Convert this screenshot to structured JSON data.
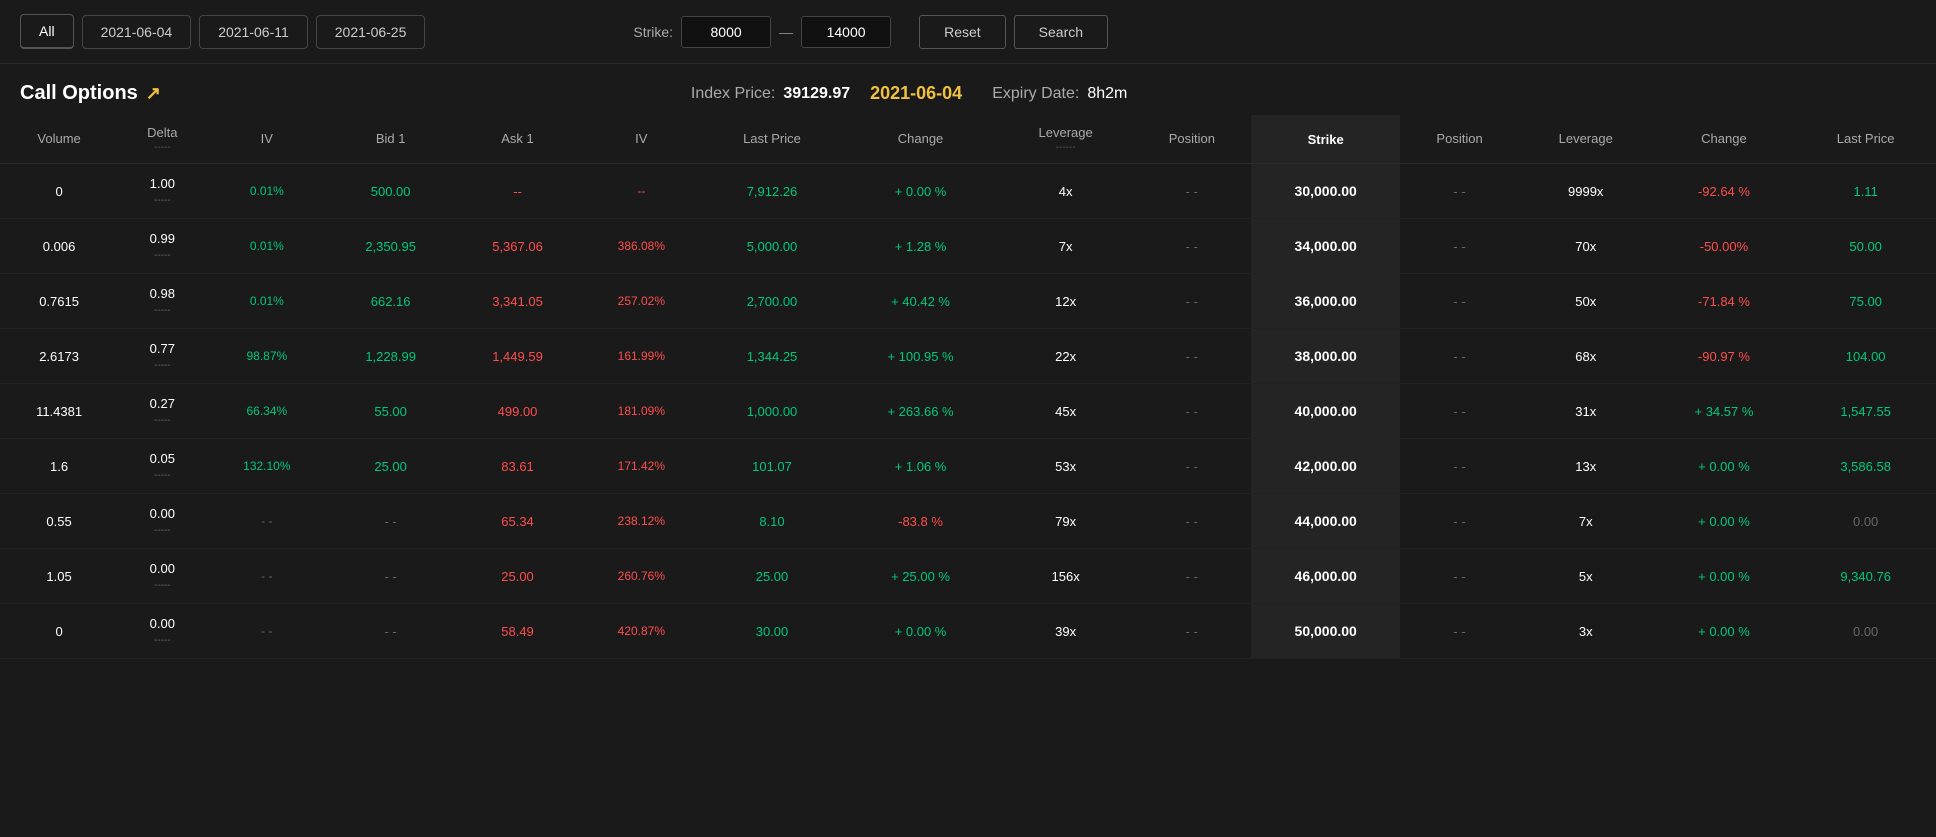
{
  "topbar": {
    "tabs": [
      {
        "label": "All",
        "active": true
      },
      {
        "label": "2021-06-04",
        "active": false
      },
      {
        "label": "2021-06-11",
        "active": false
      },
      {
        "label": "2021-06-25",
        "active": false
      }
    ],
    "strike_label": "Strike:",
    "strike_min": "8000",
    "strike_max": "14000",
    "dash": "—",
    "reset_label": "Reset",
    "search_label": "Search"
  },
  "section": {
    "title": "Call Options",
    "arrow": "↗",
    "index_price_label": "Index Price:",
    "index_price_value": "39129.97",
    "expiry_date": "2021-06-04",
    "expiry_label": "Expiry Date:",
    "expiry_value": "8h2m"
  },
  "columns": {
    "left": [
      "Volume",
      "Delta",
      "IV",
      "Bid 1",
      "Ask 1",
      "IV",
      "Last Price",
      "Change",
      "Leverage",
      "Position"
    ],
    "left_sub": [
      "",
      "-----",
      "",
      "",
      "",
      "",
      "",
      "",
      "------",
      ""
    ],
    "center": "Strike",
    "right": [
      "Position",
      "Leverage",
      "Change",
      "Last Price"
    ]
  },
  "rows": [
    {
      "volume": "0",
      "delta": "1.00",
      "delta_sub": "-----",
      "iv_left": "0.01%",
      "bid1": "500.00",
      "ask1": "--",
      "iv_right": "--",
      "last_price": "7,912.26",
      "change": "+ 0.00 %",
      "leverage": "4x",
      "position_left": "- -",
      "strike": "30,000.00",
      "position_right": "- -",
      "leverage_right": "9999x",
      "change_right": "-92.64 %",
      "last_price_right": "1.11"
    },
    {
      "volume": "0.006",
      "delta": "0.99",
      "delta_sub": "-----",
      "iv_left": "0.01%",
      "bid1": "2,350.95",
      "ask1": "5,367.06",
      "iv_right": "386.08%",
      "last_price": "5,000.00",
      "change": "+ 1.28 %",
      "leverage": "7x",
      "position_left": "- -",
      "strike": "34,000.00",
      "position_right": "- -",
      "leverage_right": "70x",
      "change_right": "-50.00%",
      "last_price_right": "50.00"
    },
    {
      "volume": "0.7615",
      "delta": "0.98",
      "delta_sub": "-----",
      "iv_left": "0.01%",
      "bid1": "662.16",
      "ask1": "3,341.05",
      "iv_right": "257.02%",
      "last_price": "2,700.00",
      "change": "+ 40.42 %",
      "leverage": "12x",
      "position_left": "- -",
      "strike": "36,000.00",
      "position_right": "- -",
      "leverage_right": "50x",
      "change_right": "-71.84 %",
      "last_price_right": "75.00"
    },
    {
      "volume": "2.6173",
      "delta": "0.77",
      "delta_sub": "-----",
      "iv_left": "98.87%",
      "bid1": "1,228.99",
      "ask1": "1,449.59",
      "iv_right": "161.99%",
      "last_price": "1,344.25",
      "change": "+ 100.95 %",
      "leverage": "22x",
      "position_left": "- -",
      "strike": "38,000.00",
      "position_right": "- -",
      "leverage_right": "68x",
      "change_right": "-90.97 %",
      "last_price_right": "104.00"
    },
    {
      "volume": "11.4381",
      "delta": "0.27",
      "delta_sub": "-----",
      "iv_left": "66.34%",
      "bid1": "55.00",
      "ask1": "499.00",
      "iv_right": "181.09%",
      "last_price": "1,000.00",
      "change": "+ 263.66 %",
      "leverage": "45x",
      "position_left": "- -",
      "strike": "40,000.00",
      "position_right": "- -",
      "leverage_right": "31x",
      "change_right": "+ 34.57 %",
      "last_price_right": "1,547.55"
    },
    {
      "volume": "1.6",
      "delta": "0.05",
      "delta_sub": "-----",
      "iv_left": "132.10%",
      "bid1": "25.00",
      "ask1": "83.61",
      "iv_right": "171.42%",
      "last_price": "101.07",
      "change": "+ 1.06 %",
      "leverage": "53x",
      "position_left": "- -",
      "strike": "42,000.00",
      "position_right": "- -",
      "leverage_right": "13x",
      "change_right": "+ 0.00 %",
      "last_price_right": "3,586.58"
    },
    {
      "volume": "0.55",
      "delta": "0.00",
      "delta_sub": "-----",
      "iv_left": "- -",
      "bid1": "- -",
      "ask1": "65.34",
      "iv_right": "238.12%",
      "last_price": "8.10",
      "change": "-83.8 %",
      "leverage": "79x",
      "position_left": "- -",
      "strike": "44,000.00",
      "position_right": "- -",
      "leverage_right": "7x",
      "change_right": "+ 0.00 %",
      "last_price_right": "0.00"
    },
    {
      "volume": "1.05",
      "delta": "0.00",
      "delta_sub": "-----",
      "iv_left": "- -",
      "bid1": "- -",
      "ask1": "25.00",
      "iv_right": "260.76%",
      "last_price": "25.00",
      "change": "+ 25.00 %",
      "leverage": "156x",
      "position_left": "- -",
      "strike": "46,000.00",
      "position_right": "- -",
      "leverage_right": "5x",
      "change_right": "+ 0.00 %",
      "last_price_right": "9,340.76"
    },
    {
      "volume": "0",
      "delta": "0.00",
      "delta_sub": "-----",
      "iv_left": "- -",
      "bid1": "- -",
      "ask1": "58.49",
      "iv_right": "420.87%",
      "last_price": "30.00",
      "change": "+ 0.00 %",
      "leverage": "39x",
      "position_left": "- -",
      "strike": "50,000.00",
      "position_right": "- -",
      "leverage_right": "3x",
      "change_right": "+ 0.00 %",
      "last_price_right": "0.00"
    }
  ]
}
